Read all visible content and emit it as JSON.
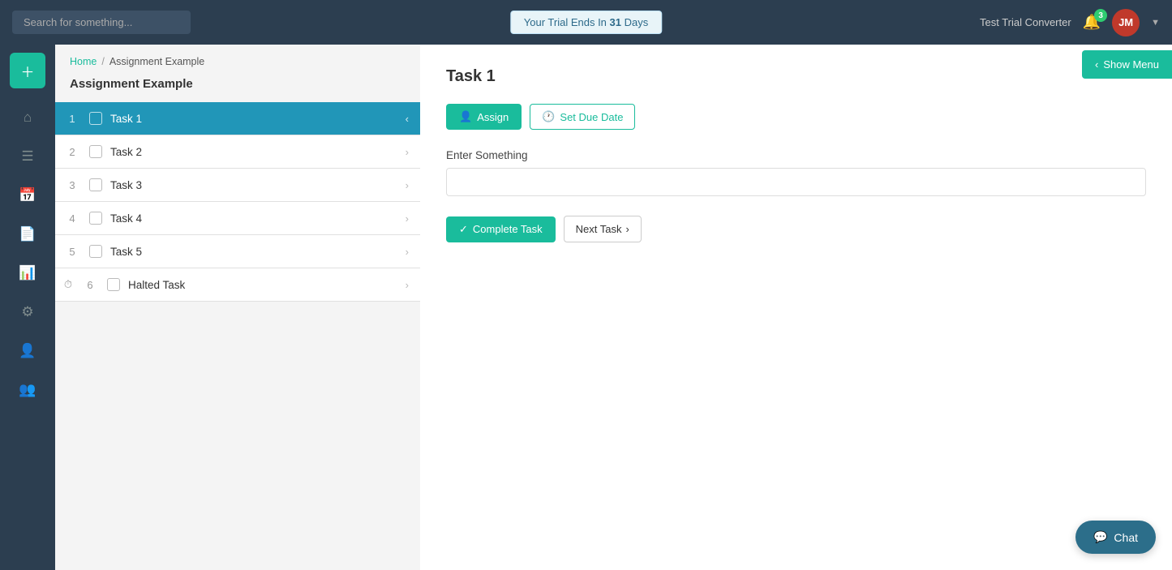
{
  "navbar": {
    "search_placeholder": "Search for something...",
    "trial_text": "Your Trial Ends In ",
    "trial_days": "31",
    "trial_days_suffix": " Days",
    "account_name": "Test Trial Converter",
    "bell_badge": "3",
    "avatar_initials": "JM"
  },
  "sidebar": {
    "add_label": "+",
    "icons": [
      "home",
      "list",
      "calendar",
      "document",
      "chart",
      "settings",
      "user",
      "team"
    ]
  },
  "breadcrumb": {
    "home_label": "Home",
    "separator": "/",
    "current": "Assignment Example"
  },
  "panel": {
    "title": "Assignment Example",
    "tasks": [
      {
        "num": "1",
        "label": "Task 1",
        "active": true
      },
      {
        "num": "2",
        "label": "Task 2",
        "active": false
      },
      {
        "num": "3",
        "label": "Task 3",
        "active": false
      },
      {
        "num": "4",
        "label": "Task 4",
        "active": false
      },
      {
        "num": "5",
        "label": "Task 5",
        "active": false
      },
      {
        "num": "6",
        "label": "Halted Task",
        "active": false,
        "halted": true
      }
    ]
  },
  "content": {
    "task_title": "Task 1",
    "assign_btn": "Assign",
    "set_due_date_btn": "Set Due Date",
    "field_label": "Enter Something",
    "field_placeholder": "",
    "complete_task_btn": "Complete Task",
    "next_task_btn": "Next Task"
  },
  "show_menu": {
    "label": "Show Menu"
  },
  "chat": {
    "label": "Chat"
  }
}
